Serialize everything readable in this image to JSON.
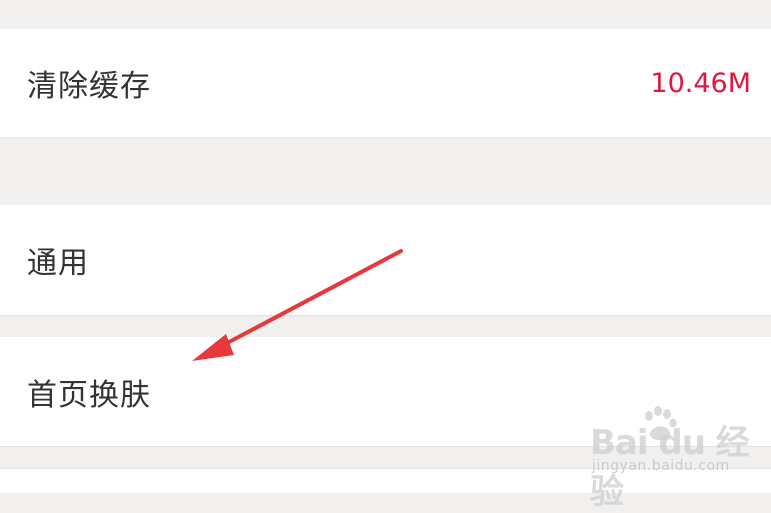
{
  "settings": {
    "clear_cache": {
      "label": "清除缓存",
      "value": "10.46M"
    },
    "general": {
      "label": "通用"
    },
    "home_skin": {
      "label": "首页换肤"
    }
  },
  "watermark": {
    "logo": "Bai du 经验",
    "url": "jingyan.baidu.com"
  },
  "colors": {
    "accent": "#e0183d",
    "arrow": "#e8383c",
    "background": "#f1f0ee"
  },
  "icons": {
    "annotation": "arrow-icon",
    "watermark": "paw-icon"
  }
}
